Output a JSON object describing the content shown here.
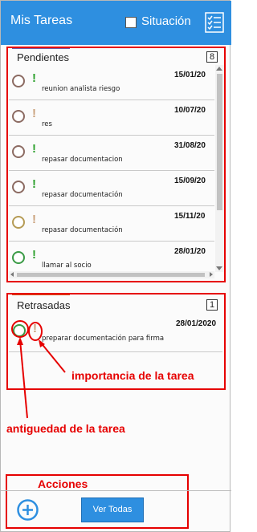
{
  "header": {
    "title": "Mis Tareas",
    "checkbox_label": "Situación",
    "list_icon": "checklist-icon"
  },
  "pendientes": {
    "title": "Pendientes",
    "count": "8",
    "items": [
      {
        "date": "15/01/20",
        "text": "reunion analista riesgo",
        "importance_color": "#2ca02c",
        "age_color": "#8c6b62"
      },
      {
        "date": "10/07/20",
        "text": "res",
        "importance_color": "#c9a07a",
        "age_color": "#8c6b62"
      },
      {
        "date": "31/08/20",
        "text": "repasar documentacion",
        "importance_color": "#2ca02c",
        "age_color": "#8c6b62"
      },
      {
        "date": "15/09/20",
        "text": "repasar documentación",
        "importance_color": "#2ca02c",
        "age_color": "#8c6b62"
      },
      {
        "date": "15/11/20",
        "text": "repasar documentación",
        "importance_color": "#c9a07a",
        "age_color": "#b59b55"
      },
      {
        "date": "28/01/20",
        "text": "llamar al socio",
        "importance_color": "#2ca02c",
        "age_color": "#3a9a45"
      }
    ]
  },
  "retrasadas": {
    "title": "Retrasadas",
    "count": "1",
    "items": [
      {
        "date": "28/01/2020",
        "text": "preparar documentación para firma",
        "importance_color": "#c9a07a",
        "age_color": "#3a9a45"
      }
    ]
  },
  "annotations": {
    "importancia": "importancia de la tarea",
    "antiguedad": "antiguedad de la tarea",
    "acciones": "Acciones"
  },
  "footer": {
    "add_icon": "plus-circle-icon",
    "view_all_label": "Ver Todas"
  },
  "colors": {
    "accent": "#2e8fe0",
    "annotation": "#e60000",
    "pendientes_bar": "#6e5ea8",
    "retrasadas_bar": "#d9541e"
  }
}
